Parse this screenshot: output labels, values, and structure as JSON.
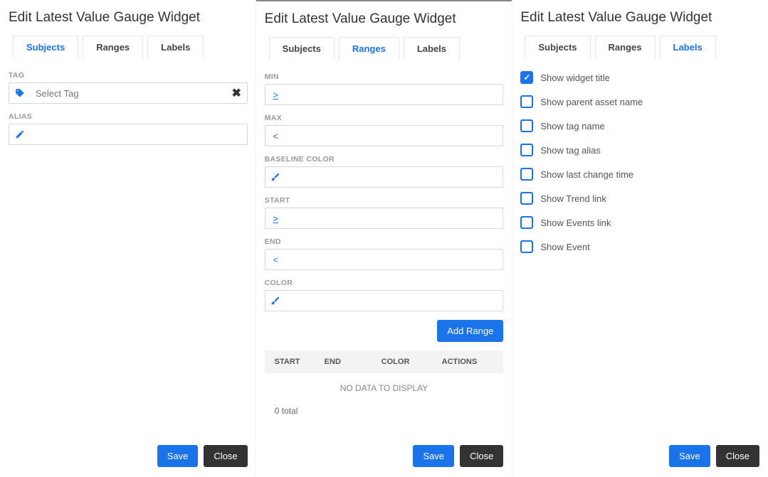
{
  "shared": {
    "title": "Edit Latest Value Gauge Widget",
    "tabs": {
      "subjects": "Subjects",
      "ranges": "Ranges",
      "labels": "Labels"
    },
    "buttons": {
      "save": "Save",
      "close": "Close"
    }
  },
  "subjects": {
    "tag_label": "TAG",
    "tag_placeholder": "Select Tag",
    "alias_label": "ALIAS"
  },
  "ranges": {
    "min_label": "MIN",
    "max_label": "MAX",
    "baseline_label": "BASELINE COLOR",
    "start_label": "START",
    "end_label": "END",
    "color_label": "COLOR",
    "gte": ">",
    "lt": "<",
    "add_range": "Add Range",
    "headers": {
      "start": "START",
      "end": "END",
      "color": "COLOR",
      "actions": "ACTIONS"
    },
    "no_data": "NO DATA TO DISPLAY",
    "total": "0 total"
  },
  "labels": {
    "options": [
      {
        "label": "Show widget title",
        "checked": true
      },
      {
        "label": "Show parent asset name",
        "checked": false
      },
      {
        "label": "Show tag name",
        "checked": false
      },
      {
        "label": "Show tag alias",
        "checked": false
      },
      {
        "label": "Show last change time",
        "checked": false
      },
      {
        "label": "Show Trend link",
        "checked": false
      },
      {
        "label": "Show Events link",
        "checked": false
      },
      {
        "label": "Show Event",
        "checked": false
      }
    ]
  }
}
